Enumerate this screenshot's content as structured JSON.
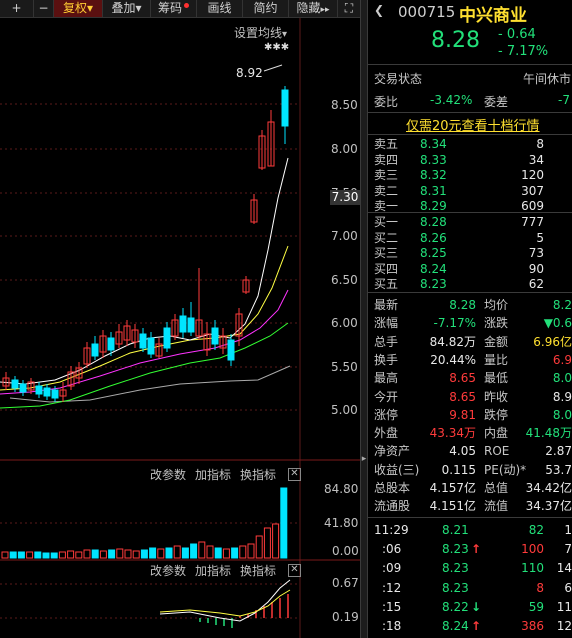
{
  "toolbar": {
    "plus": "+",
    "minus": "−",
    "fuquan": "复权",
    "fuquan_arrow": "▾",
    "diejia": "叠加",
    "diejia_arrow": "▾",
    "chouma": "筹码",
    "huaxian": "画线",
    "jianyue": "简约",
    "yincang": "隐藏",
    "yincang_arrow": "▸▸",
    "expand": "⛶"
  },
  "chart": {
    "settings": "设置均线",
    "settings_arrow": "▾",
    "high_marker": "8.92",
    "star_marks": "✱✱✱",
    "price_axis": [
      "8.50",
      "8.00",
      "7.50",
      "7.00",
      "6.50",
      "6.00",
      "5.50",
      "5.00"
    ],
    "current_price_label": "7.30",
    "volume_panel": {
      "btn_params": "改参数",
      "btn_add": "加指标",
      "btn_switch": "换指标",
      "close": "✕",
      "axis": [
        "84.80",
        "41.80",
        "0.00"
      ]
    },
    "macd_panel": {
      "btn_params": "改参数",
      "btn_add": "加指标",
      "btn_switch": "换指标",
      "close": "✕",
      "axis": [
        "0.67",
        "0.19"
      ]
    }
  },
  "quote": {
    "code": "000715",
    "name": "中兴商业",
    "price": "8.28",
    "change": "- 0.64",
    "change_pct": "- 7.17%",
    "status_label": "交易状态",
    "status_value": "午间休市",
    "weibi_label": "委比",
    "weibi_value": "-3.42%",
    "weicha_label": "委差",
    "weicha_value": "-7",
    "promo": "仅需20元查看十档行情",
    "asks": [
      {
        "label": "卖五",
        "price": "8.34",
        "vol": "8"
      },
      {
        "label": "卖四",
        "price": "8.33",
        "vol": "34"
      },
      {
        "label": "卖三",
        "price": "8.32",
        "vol": "120"
      },
      {
        "label": "卖二",
        "price": "8.31",
        "vol": "307"
      },
      {
        "label": "卖一",
        "price": "8.29",
        "vol": "609"
      }
    ],
    "bids": [
      {
        "label": "买一",
        "price": "8.28",
        "vol": "777"
      },
      {
        "label": "买二",
        "price": "8.26",
        "vol": "5"
      },
      {
        "label": "买三",
        "price": "8.25",
        "vol": "73"
      },
      {
        "label": "买四",
        "price": "8.24",
        "vol": "90"
      },
      {
        "label": "买五",
        "price": "8.23",
        "vol": "62"
      }
    ],
    "stats": [
      {
        "l1": "最新",
        "v1": "8.28",
        "c1": "green",
        "l2": "均价",
        "v2": "8.2",
        "c2": "green"
      },
      {
        "l1": "涨幅",
        "v1": "-7.17%",
        "c1": "green",
        "l2": "涨跌",
        "v2": "▼0.6",
        "c2": "green"
      },
      {
        "l1": "总手",
        "v1": "84.82万",
        "c1": "white",
        "l2": "金额",
        "v2": "6.96亿",
        "c2": "yellow"
      },
      {
        "l1": "换手",
        "v1": "20.44%",
        "c1": "white",
        "l2": "量比",
        "v2": "6.9",
        "c2": "red"
      },
      {
        "l1": "最高",
        "v1": "8.65",
        "c1": "red",
        "l2": "最低",
        "v2": "8.0",
        "c2": "green"
      },
      {
        "l1": "今开",
        "v1": "8.65",
        "c1": "red",
        "l2": "昨收",
        "v2": "8.9",
        "c2": "white"
      },
      {
        "l1": "涨停",
        "v1": "9.81",
        "c1": "red",
        "l2": "跌停",
        "v2": "8.0",
        "c2": "green"
      },
      {
        "l1": "外盘",
        "v1": "43.34万",
        "c1": "red",
        "l2": "内盘",
        "v2": "41.48万",
        "c2": "green"
      },
      {
        "l1": "净资产",
        "v1": "4.05",
        "c1": "white",
        "l2": "ROE",
        "v2": "2.87",
        "c2": "white"
      },
      {
        "l1": "收益(三)",
        "v1": "0.115",
        "c1": "white",
        "l2": "PE(动)*",
        "v2": "53.7",
        "c2": "white"
      },
      {
        "l1": "总股本",
        "v1": "4.157亿",
        "c1": "white",
        "l2": "总值",
        "v2": "34.42亿",
        "c2": "white"
      },
      {
        "l1": "流通股",
        "v1": "4.151亿",
        "c1": "white",
        "l2": "流值",
        "v2": "34.37亿",
        "c2": "white"
      }
    ],
    "ticks": [
      {
        "time": "11:29",
        "price": "8.21",
        "pc": "green",
        "arrow": "",
        "vol": "82",
        "vc": "green",
        "n": "1"
      },
      {
        "time": ":06",
        "price": "8.23",
        "pc": "green",
        "arrow": "↑",
        "ac": "red",
        "vol": "100",
        "vc": "red",
        "n": "7"
      },
      {
        "time": ":09",
        "price": "8.23",
        "pc": "green",
        "arrow": "",
        "vol": "110",
        "vc": "green",
        "n": "14"
      },
      {
        "time": ":12",
        "price": "8.23",
        "pc": "green",
        "arrow": "",
        "vol": "8",
        "vc": "red",
        "n": "6"
      },
      {
        "time": ":15",
        "price": "8.22",
        "pc": "green",
        "arrow": "↓",
        "ac": "green",
        "vol": "59",
        "vc": "green",
        "n": "11"
      },
      {
        "time": ":18",
        "price": "8.24",
        "pc": "green",
        "arrow": "↑",
        "ac": "red",
        "vol": "386",
        "vc": "red",
        "n": "12"
      }
    ]
  },
  "colors": {
    "up": "#ff3b3b",
    "down": "#22e07a",
    "cyan_candle": "#00e5ff",
    "ma5": "#ffffff",
    "ma10": "#ffff44",
    "ma20": "#ff33ff",
    "ma30": "#33ff33"
  }
}
